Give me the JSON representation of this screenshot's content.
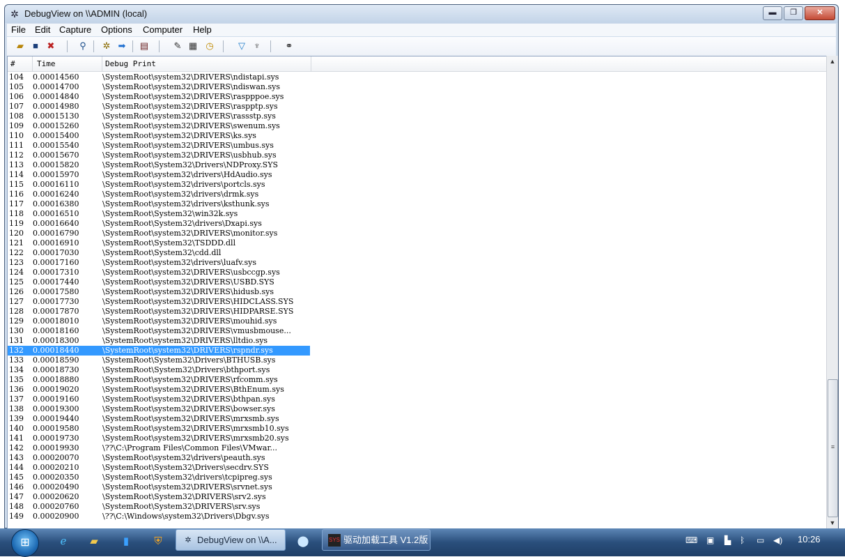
{
  "window": {
    "title": "DebugView on \\\\ADMIN (local)",
    "app_icon": "spider-icon",
    "controls": {
      "minimize": "▬",
      "maximize": "❐",
      "close": "✕"
    }
  },
  "menu": [
    "File",
    "Edit",
    "Capture",
    "Options",
    "Computer",
    "Help"
  ],
  "toolbar_icons": [
    "open-folder-icon",
    "save-icon",
    "clear-display-icon",
    "find-icon",
    "capture-icon",
    "autoscroll-arrow-icon",
    "connect-icon",
    "filter-highlight-icon",
    "history-depth-icon",
    "clock-time-icon",
    "filter-icon",
    "highlight-icon",
    "find-binoculars-icon"
  ],
  "columns": {
    "num": "#",
    "time": "Time",
    "msg": "Debug Print"
  },
  "rows": [
    {
      "n": "104",
      "t": "0.00014560",
      "m": "\\SystemRoot\\system32\\DRIVERS\\ndistapi.sys"
    },
    {
      "n": "105",
      "t": "0.00014700",
      "m": "\\SystemRoot\\system32\\DRIVERS\\ndiswan.sys"
    },
    {
      "n": "106",
      "t": "0.00014840",
      "m": "\\SystemRoot\\system32\\DRIVERS\\raspppoe.sys"
    },
    {
      "n": "107",
      "t": "0.00014980",
      "m": "\\SystemRoot\\system32\\DRIVERS\\raspptp.sys"
    },
    {
      "n": "108",
      "t": "0.00015130",
      "m": "\\SystemRoot\\system32\\DRIVERS\\rassstp.sys"
    },
    {
      "n": "109",
      "t": "0.00015260",
      "m": "\\SystemRoot\\system32\\DRIVERS\\swenum.sys"
    },
    {
      "n": "110",
      "t": "0.00015400",
      "m": "\\SystemRoot\\system32\\DRIVERS\\ks.sys"
    },
    {
      "n": "111",
      "t": "0.00015540",
      "m": "\\SystemRoot\\system32\\DRIVERS\\umbus.sys"
    },
    {
      "n": "112",
      "t": "0.00015670",
      "m": "\\SystemRoot\\system32\\DRIVERS\\usbhub.sys"
    },
    {
      "n": "113",
      "t": "0.00015820",
      "m": "\\SystemRoot\\System32\\Drivers\\NDProxy.SYS"
    },
    {
      "n": "114",
      "t": "0.00015970",
      "m": "\\SystemRoot\\system32\\drivers\\HdAudio.sys"
    },
    {
      "n": "115",
      "t": "0.00016110",
      "m": "\\SystemRoot\\system32\\drivers\\portcls.sys"
    },
    {
      "n": "116",
      "t": "0.00016240",
      "m": "\\SystemRoot\\system32\\drivers\\drmk.sys"
    },
    {
      "n": "117",
      "t": "0.00016380",
      "m": "\\SystemRoot\\system32\\drivers\\ksthunk.sys"
    },
    {
      "n": "118",
      "t": "0.00016510",
      "m": "\\SystemRoot\\System32\\win32k.sys"
    },
    {
      "n": "119",
      "t": "0.00016640",
      "m": "\\SystemRoot\\System32\\drivers\\Dxapi.sys"
    },
    {
      "n": "120",
      "t": "0.00016790",
      "m": "\\SystemRoot\\system32\\DRIVERS\\monitor.sys"
    },
    {
      "n": "121",
      "t": "0.00016910",
      "m": "\\SystemRoot\\System32\\TSDDD.dll"
    },
    {
      "n": "122",
      "t": "0.00017030",
      "m": "\\SystemRoot\\System32\\cdd.dll"
    },
    {
      "n": "123",
      "t": "0.00017160",
      "m": "\\SystemRoot\\system32\\drivers\\luafv.sys"
    },
    {
      "n": "124",
      "t": "0.00017310",
      "m": "\\SystemRoot\\system32\\DRIVERS\\usbccgp.sys"
    },
    {
      "n": "125",
      "t": "0.00017440",
      "m": "\\SystemRoot\\system32\\DRIVERS\\USBD.SYS"
    },
    {
      "n": "126",
      "t": "0.00017580",
      "m": "\\SystemRoot\\system32\\DRIVERS\\hidusb.sys"
    },
    {
      "n": "127",
      "t": "0.00017730",
      "m": "\\SystemRoot\\system32\\DRIVERS\\HIDCLASS.SYS"
    },
    {
      "n": "128",
      "t": "0.00017870",
      "m": "\\SystemRoot\\system32\\DRIVERS\\HIDPARSE.SYS"
    },
    {
      "n": "129",
      "t": "0.00018010",
      "m": "\\SystemRoot\\system32\\DRIVERS\\mouhid.sys"
    },
    {
      "n": "130",
      "t": "0.00018160",
      "m": "\\SystemRoot\\system32\\DRIVERS\\vmusbmouse..."
    },
    {
      "n": "131",
      "t": "0.00018300",
      "m": "\\SystemRoot\\system32\\DRIVERS\\lltdio.sys"
    },
    {
      "n": "132",
      "t": "0.00018440",
      "m": "\\SystemRoot\\system32\\DRIVERS\\rspndr.sys",
      "selected": true
    },
    {
      "n": "133",
      "t": "0.00018590",
      "m": "\\SystemRoot\\System32\\Drivers\\BTHUSB.sys"
    },
    {
      "n": "134",
      "t": "0.00018730",
      "m": "\\SystemRoot\\System32\\Drivers\\bthport.sys"
    },
    {
      "n": "135",
      "t": "0.00018880",
      "m": "\\SystemRoot\\system32\\DRIVERS\\rfcomm.sys"
    },
    {
      "n": "136",
      "t": "0.00019020",
      "m": "\\SystemRoot\\system32\\DRIVERS\\BthEnum.sys"
    },
    {
      "n": "137",
      "t": "0.00019160",
      "m": "\\SystemRoot\\system32\\DRIVERS\\bthpan.sys"
    },
    {
      "n": "138",
      "t": "0.00019300",
      "m": "\\SystemRoot\\system32\\DRIVERS\\bowser.sys"
    },
    {
      "n": "139",
      "t": "0.00019440",
      "m": "\\SystemRoot\\system32\\DRIVERS\\mrxsmb.sys"
    },
    {
      "n": "140",
      "t": "0.00019580",
      "m": "\\SystemRoot\\system32\\DRIVERS\\mrxsmb10.sys"
    },
    {
      "n": "141",
      "t": "0.00019730",
      "m": "\\SystemRoot\\system32\\DRIVERS\\mrxsmb20.sys"
    },
    {
      "n": "142",
      "t": "0.00019930",
      "m": "\\??\\C:\\Program Files\\Common Files\\VMwar..."
    },
    {
      "n": "143",
      "t": "0.00020070",
      "m": "\\SystemRoot\\system32\\drivers\\peauth.sys"
    },
    {
      "n": "144",
      "t": "0.00020210",
      "m": "\\SystemRoot\\System32\\Drivers\\secdrv.SYS"
    },
    {
      "n": "145",
      "t": "0.00020350",
      "m": "\\SystemRoot\\System32\\drivers\\tcpipreg.sys"
    },
    {
      "n": "146",
      "t": "0.00020490",
      "m": "\\SystemRoot\\system32\\DRIVERS\\srvnet.sys"
    },
    {
      "n": "147",
      "t": "0.00020620",
      "m": "\\SystemRoot\\System32\\DRIVERS\\srv2.sys"
    },
    {
      "n": "148",
      "t": "0.00020760",
      "m": "\\SystemRoot\\System32\\DRIVERS\\srv.sys"
    },
    {
      "n": "149",
      "t": "0.00020900",
      "m": "\\??\\C:\\Windows\\system32\\Drivers\\Dbgv.sys"
    }
  ],
  "taskbar": {
    "tasks": [
      {
        "label": "DebugView on \\\\A...",
        "icon": "spider-icon"
      },
      {
        "label": "驱动加载工具 V1.2版",
        "icon": "sys-icon",
        "icon_text": "SYS"
      }
    ],
    "clock": "10:26"
  }
}
